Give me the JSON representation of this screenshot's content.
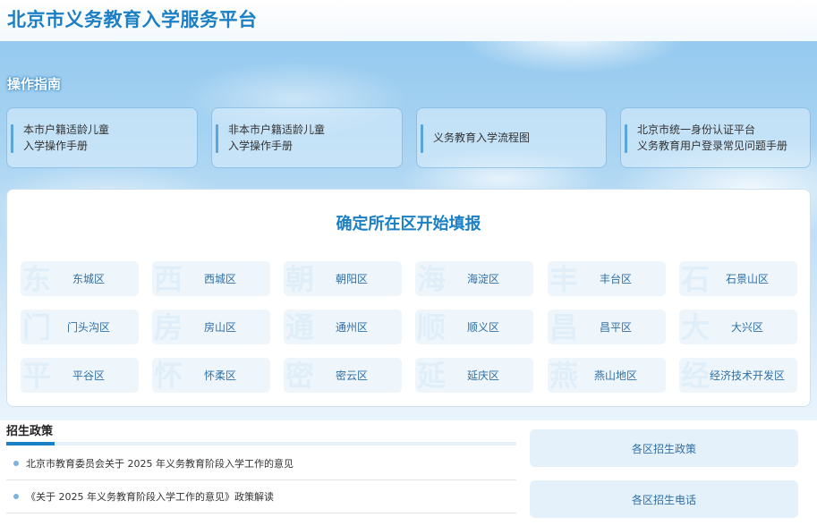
{
  "header": {
    "title": "北京市义务教育入学服务平台"
  },
  "guide": {
    "heading": "操作指南",
    "cards": [
      {
        "line1": "本市户籍适龄儿童",
        "line2": "入学操作手册"
      },
      {
        "line1": "非本市户籍适龄儿童",
        "line2": "入学操作手册"
      },
      {
        "line1": "义务教育入学流程图",
        "line2": ""
      },
      {
        "line1": "北京市统一身份认证平台",
        "line2": "义务教育用户登录常见问题手册"
      }
    ]
  },
  "districts": {
    "title": "确定所在区开始填报",
    "items": [
      {
        "label": "东城区",
        "watermark": "东"
      },
      {
        "label": "西城区",
        "watermark": "西"
      },
      {
        "label": "朝阳区",
        "watermark": "朝"
      },
      {
        "label": "海淀区",
        "watermark": "海"
      },
      {
        "label": "丰台区",
        "watermark": "丰"
      },
      {
        "label": "石景山区",
        "watermark": "石"
      },
      {
        "label": "门头沟区",
        "watermark": "门"
      },
      {
        "label": "房山区",
        "watermark": "房"
      },
      {
        "label": "通州区",
        "watermark": "通"
      },
      {
        "label": "顺义区",
        "watermark": "顺"
      },
      {
        "label": "昌平区",
        "watermark": "昌"
      },
      {
        "label": "大兴区",
        "watermark": "大"
      },
      {
        "label": "平谷区",
        "watermark": "平"
      },
      {
        "label": "怀柔区",
        "watermark": "怀"
      },
      {
        "label": "密云区",
        "watermark": "密"
      },
      {
        "label": "延庆区",
        "watermark": "延"
      },
      {
        "label": "燕山地区",
        "watermark": "燕"
      },
      {
        "label": "经济技术开发区",
        "watermark": "经"
      }
    ]
  },
  "policy": {
    "heading": "招生政策",
    "items": [
      "北京市教育委员会关于 2025 年义务教育阶段入学工作的意见",
      "《关于 2025 年义务教育阶段入学工作的意见》政策解读"
    ]
  },
  "side_buttons": {
    "district_policy": "各区招生政策",
    "district_phone": "各区招生电话"
  },
  "colors": {
    "brand_blue": "#1a7fc4",
    "district_text": "#2f6fa5",
    "card_bg": "#eef6fc"
  }
}
